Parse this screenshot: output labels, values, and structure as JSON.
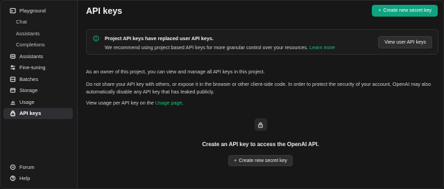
{
  "sidebar": {
    "items": [
      {
        "label": "Playground",
        "icon": "terminal-icon",
        "sub": false
      },
      {
        "label": "Chat",
        "icon": "",
        "sub": true
      },
      {
        "label": "Assistants",
        "icon": "",
        "sub": true
      },
      {
        "label": "Completions",
        "icon": "",
        "sub": true
      },
      {
        "label": "Assistants",
        "icon": "assistant-icon",
        "sub": false
      },
      {
        "label": "Fine-tuning",
        "icon": "tune-icon",
        "sub": false
      },
      {
        "label": "Batches",
        "icon": "batch-icon",
        "sub": false
      },
      {
        "label": "Storage",
        "icon": "storage-icon",
        "sub": false
      },
      {
        "label": "Usage",
        "icon": "usage-icon",
        "sub": false
      },
      {
        "label": "API keys",
        "icon": "lock-icon",
        "sub": false,
        "active": true
      }
    ],
    "bottom": [
      {
        "label": "Forum",
        "icon": "forum-icon"
      },
      {
        "label": "Help",
        "icon": "help-icon"
      }
    ]
  },
  "header": {
    "title": "API keys",
    "create_button": "Create new secret key"
  },
  "notice": {
    "title": "Project API keys have replaced user API keys.",
    "body": "We recommend using project based API keys for more granular control over your resources.",
    "link": "Learn more",
    "button": "View user API keys"
  },
  "content": {
    "para1": "As an owner of this project, you can view and manage all API keys in this project.",
    "para2": "Do not share your API key with others, or expose it in the browser or other client-side code. In order to protect the security of your account, OpenAI may also automatically disable any API key that has leaked publicly.",
    "para3_prefix": "View usage per API key on the",
    "para3_link": "Usage page",
    "para3_suffix": "."
  },
  "empty_state": {
    "text": "Create an API key to access the OpenAI API.",
    "button": "Create new secret key"
  },
  "colors": {
    "accent": "#10a37f",
    "link": "#19c37d",
    "background": "#171717",
    "sidebar": "#1b1b1b"
  }
}
